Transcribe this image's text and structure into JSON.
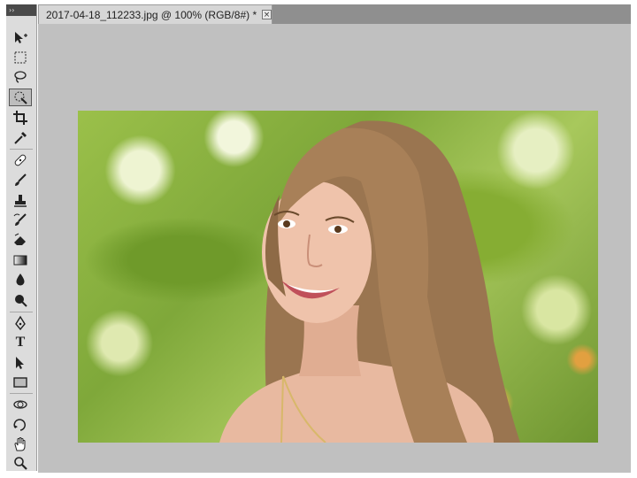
{
  "toolbox": {
    "header_glyph": "››",
    "tools": [
      {
        "name": "move-tool",
        "icon": "move-icon"
      },
      {
        "name": "marquee-tool",
        "icon": "rect-marquee-icon"
      },
      {
        "name": "lasso-tool",
        "icon": "lasso-icon"
      },
      {
        "name": "quick-selection-tool",
        "icon": "magic-wand-icon",
        "active": true
      },
      {
        "name": "crop-tool",
        "icon": "crop-icon"
      },
      {
        "name": "eyedropper-tool",
        "icon": "eyedropper-icon"
      },
      {
        "name": "healing-brush-tool",
        "icon": "bandage-icon"
      },
      {
        "name": "brush-tool",
        "icon": "brush-icon"
      },
      {
        "name": "clone-stamp-tool",
        "icon": "stamp-icon"
      },
      {
        "name": "history-brush-tool",
        "icon": "history-brush-icon"
      },
      {
        "name": "eraser-tool",
        "icon": "eraser-icon"
      },
      {
        "name": "gradient-tool",
        "icon": "gradient-icon"
      },
      {
        "name": "blur-tool",
        "icon": "drop-icon"
      },
      {
        "name": "dodge-tool",
        "icon": "dodge-icon"
      },
      {
        "name": "pen-tool",
        "icon": "pen-icon"
      },
      {
        "name": "type-tool",
        "icon": "type-icon",
        "glyph": "T"
      },
      {
        "name": "path-selection-tool",
        "icon": "arrow-icon"
      },
      {
        "name": "shape-tool",
        "icon": "rectangle-icon"
      },
      {
        "name": "3d-rotate-tool",
        "icon": "3d-rotate-icon"
      },
      {
        "name": "3d-orbit-tool",
        "icon": "3d-orbit-icon"
      },
      {
        "name": "hand-tool",
        "icon": "hand-icon"
      },
      {
        "name": "zoom-tool",
        "icon": "zoom-icon"
      }
    ]
  },
  "document": {
    "tab_label": "2017-04-18_112233.jpg @ 100% (RGB/8#) *",
    "close_glyph": "×"
  },
  "colors": {
    "workspace": "#c0c0c0",
    "toolbox": "#dcdcdc",
    "tab_bar": "#8f8f8f"
  }
}
